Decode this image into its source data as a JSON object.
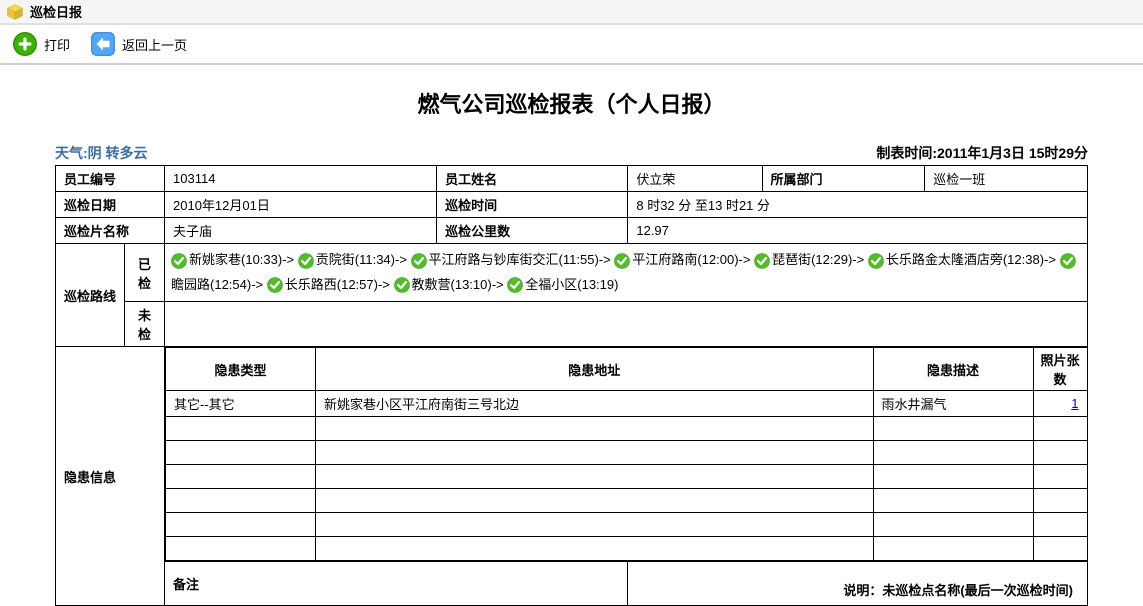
{
  "header": {
    "title": "巡检日报"
  },
  "toolbar": {
    "print_label": "打印",
    "back_label": "返回上一页"
  },
  "report": {
    "title": "燃气公司巡检报表（个人日报）",
    "weather": "天气:阴 转多云",
    "timestamp": "制表时间:2011年1月3日 15时29分",
    "labels": {
      "emp_no": "员工编号",
      "emp_name": "员工姓名",
      "department": "所属部门",
      "patrol_date": "巡检日期",
      "patrol_time": "巡检时间",
      "area_name": "巡检片名称",
      "mileage": "巡检公里数",
      "route": "巡检路线",
      "checked": "已检",
      "unchecked": "未检",
      "hazard_info": "隐患信息",
      "hazard_type": "隐患类型",
      "hazard_addr": "隐患地址",
      "hazard_desc": "隐患描述",
      "photo_count": "照片张数",
      "remark": "备注",
      "footer_note": "说明：未巡检点名称(最后一次巡检时间)"
    },
    "employee_no": "103114",
    "employee_name": "伏立荣",
    "department": "巡检一班",
    "patrol_date": "2010年12月01日",
    "patrol_time": "8 时32 分  至13 时21 分",
    "area_name": "夫子庙",
    "mileage": "12.97",
    "route": [
      {
        "point": "新姚家巷",
        "time": "(10:33)"
      },
      {
        "point": "贡院街",
        "time": "(11:34)"
      },
      {
        "point": "平江府路与钞库街交汇",
        "time": "(11:55)"
      },
      {
        "point": "平江府路南",
        "time": "(12:00)"
      },
      {
        "point": "琵琶街",
        "time": "(12:29)"
      },
      {
        "point": "长乐路金太隆酒店旁",
        "time": "(12:38)"
      },
      {
        "point": "瞻园路",
        "time": "(12:54)"
      },
      {
        "point": "长乐路西",
        "time": "(12:57)"
      },
      {
        "point": "教敷营",
        "time": "(13:10)"
      },
      {
        "point": "全福小区",
        "time": "(13:19)"
      }
    ],
    "hazards": [
      {
        "type": "其它--其它",
        "addr": "新姚家巷小区平江府南街三号北边",
        "desc": "雨水井漏气",
        "photos": "1"
      }
    ]
  }
}
